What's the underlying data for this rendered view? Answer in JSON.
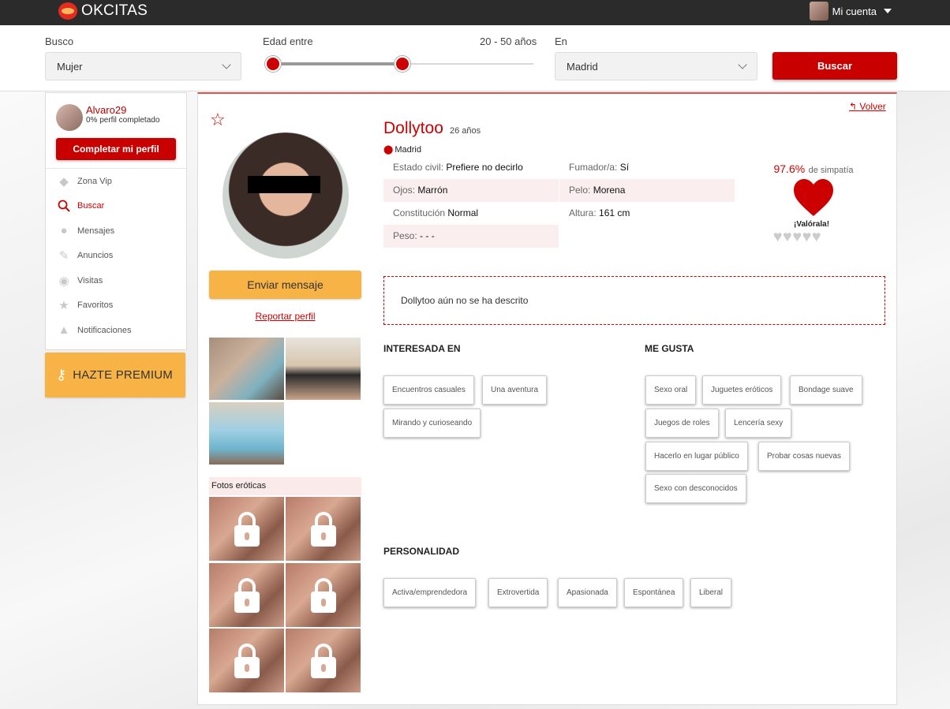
{
  "header": {
    "brand": "OKCITAS",
    "account_label": "Mi cuenta"
  },
  "search": {
    "busco_label": "Busco",
    "busco_value": "Mujer",
    "edad_label": "Edad entre",
    "edad_range": "20 - 50 años",
    "en_label": "En",
    "en_value": "Madrid",
    "button": "Buscar"
  },
  "sidebar": {
    "username": "Alvaro29",
    "profile_status": "0% perfil completado",
    "complete_button": "Completar mi perfil",
    "items": [
      {
        "label": "Zona Vip",
        "icon": "diamond-icon"
      },
      {
        "label": "Buscar",
        "icon": "search-icon"
      },
      {
        "label": "Mensajes",
        "icon": "chat-icon"
      },
      {
        "label": "Anuncios",
        "icon": "pin-icon"
      },
      {
        "label": "Visitas",
        "icon": "eye-icon"
      },
      {
        "label": "Favoritos",
        "icon": "star-icon"
      },
      {
        "label": "Notificaciones",
        "icon": "bell-icon"
      }
    ],
    "premium": "HAZTE PREMIUM"
  },
  "profile": {
    "name": "Dollytoo",
    "age": "26 años",
    "location": "Madrid",
    "back": "Volver",
    "send_message": "Enviar mensaje",
    "report": "Reportar perfil",
    "erotic_photos_title": "Fotos eróticas",
    "attrs": {
      "estado_label": "Estado civil:",
      "estado_value": "Prefiere no decirlo",
      "fumador_label": "Fumador/a:",
      "fumador_value": "Sí",
      "ojos_label": "Ojos:",
      "ojos_value": "Marrón",
      "pelo_label": "Pelo:",
      "pelo_value": "Morena",
      "constitucion_label": "Constitución",
      "constitucion_value": "Normal",
      "altura_label": "Altura:",
      "altura_value": "161 cm",
      "peso_label": "Peso:",
      "peso_value": "- - -"
    },
    "sympathy_pct": "97.6%",
    "sympathy_label": "de simpatía",
    "rate_label": "¡Valórala!",
    "rating_value": "0 of 5",
    "description": "Dollytoo aún no se ha descrito",
    "interested_title": "INTERESADA EN",
    "interested": [
      "Encuentros casuales",
      "Una aventura",
      "Mirando y curioseando"
    ],
    "likes_title": "ME GUSTA",
    "likes": [
      "Sexo oral",
      "Juguetes eróticos",
      "Bondage suave",
      "Juegos de roles",
      "Lencería sexy",
      "Hacerlo en lugar público",
      "Probar cosas nuevas",
      "Sexo con desconocidos"
    ],
    "personality_title": "PERSONALIDAD",
    "personality": [
      "Activa/emprendedora",
      "Extrovertida",
      "Apasionada",
      "Espontánea",
      "Liberal"
    ]
  },
  "colors": {
    "accent": "#c80000",
    "premium": "#f8b347",
    "topbar": "#2b2b2b"
  }
}
